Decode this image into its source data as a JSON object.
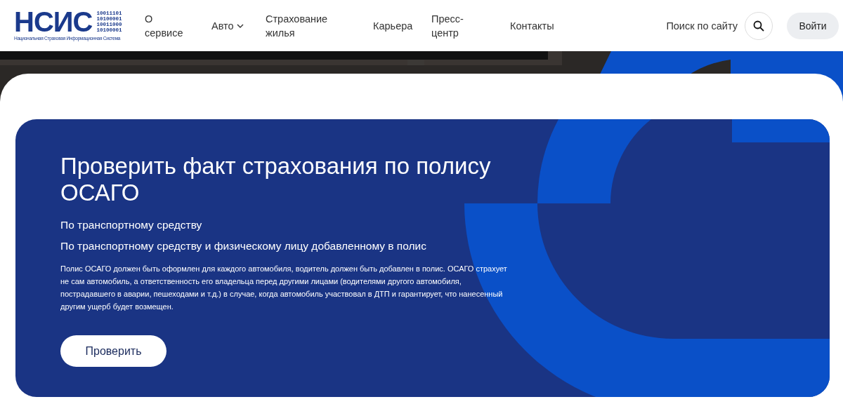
{
  "header": {
    "logo": {
      "letters": "НСИС",
      "binary": [
        "10011101",
        "10100001",
        "10011000",
        "10100001"
      ],
      "subtitle": "Национальная Страховая Информационная Система"
    },
    "nav": [
      {
        "label": "О сервисе",
        "kind": "link"
      },
      {
        "label": "Авто",
        "kind": "dropdown"
      },
      {
        "label": "Страхование жилья",
        "kind": "link"
      },
      {
        "label": "Карьера",
        "kind": "link"
      },
      {
        "label": "Пресс-центр",
        "kind": "link"
      },
      {
        "label": "Контакты",
        "kind": "link"
      }
    ],
    "search_label": "Поиск по сайту",
    "login": "Войти"
  },
  "card": {
    "title": "Проверить факт страхования по полису ОСАГО",
    "options": [
      "По транспортному средству",
      "По транспортному средству и физическому лицу добавленному в полис"
    ],
    "description": "Полис ОСАГО должен быть оформлен для каждого автомобиля, водитель должен быть добавлен в полис. ОСАГО страхует не сам автомобиль, а ответственность его владельца перед другими лицами (водителями другого автомобиля, пострадавшего в аварии, пешеходами и т.д.) в случае, когда автомобиль участвовал в ДТП и гарантирует, что нанесенный другим ущерб будет возмещен.",
    "button": "Проверить"
  }
}
